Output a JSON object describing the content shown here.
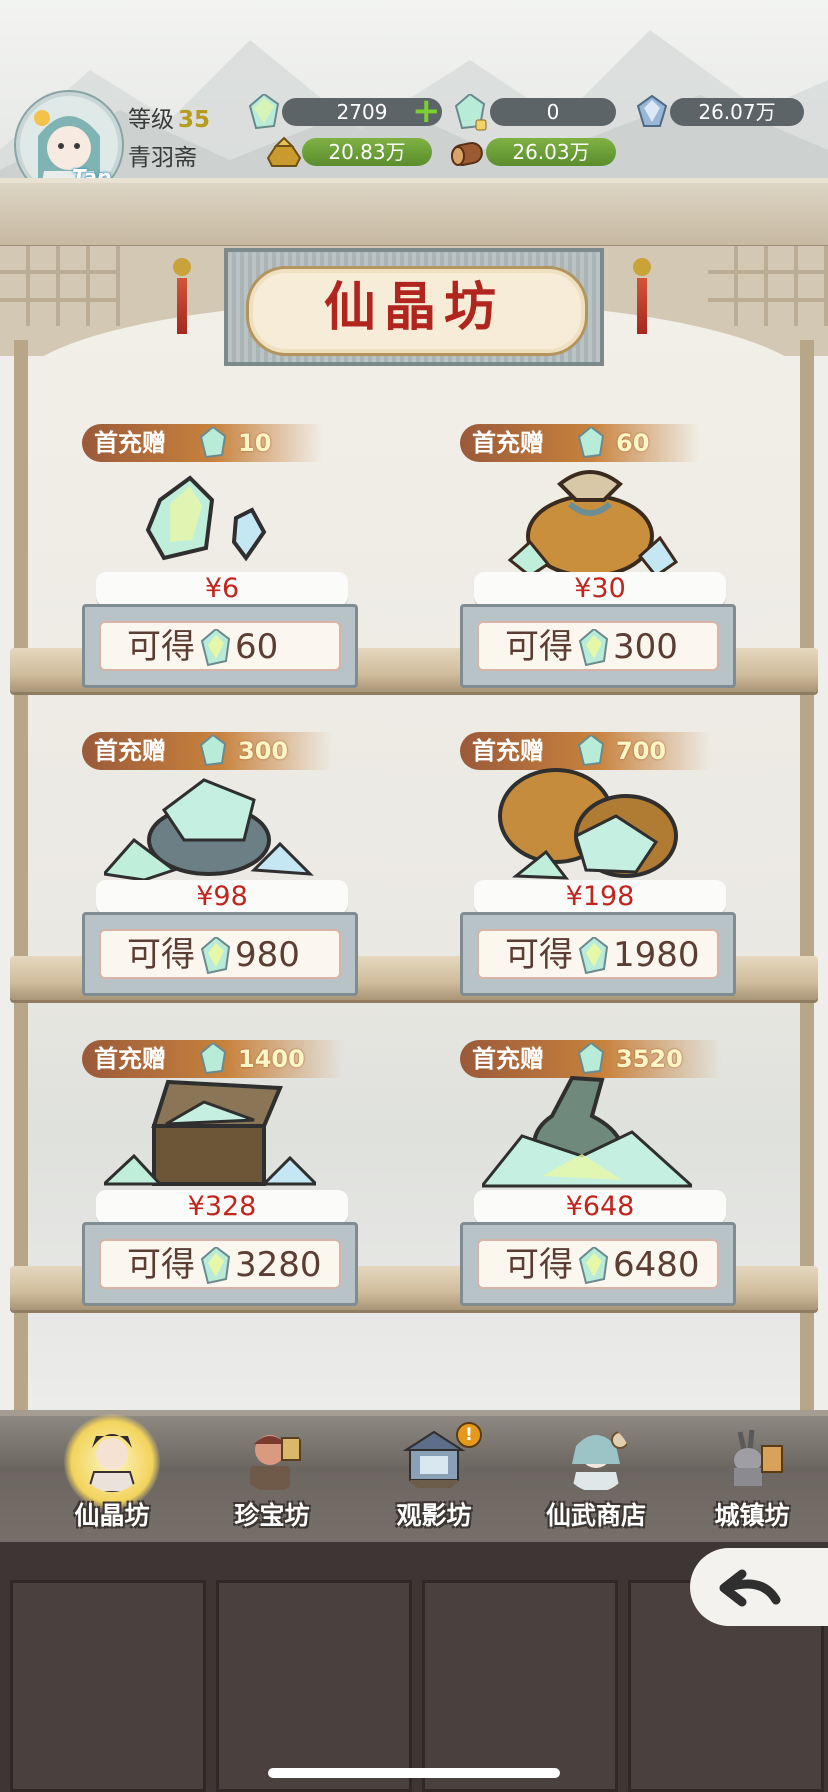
{
  "header": {
    "level_label": "等级",
    "level_value": "35",
    "player_name": "青羽斋",
    "avatar_badge": "Tap",
    "resources": {
      "crystal": "2709",
      "bound_crystal": "0",
      "spirit_stone": "26.07万",
      "gold": "20.83万",
      "wood": "26.03万"
    }
  },
  "shop": {
    "title": "仙晶坊",
    "bonus_label": "首充赠",
    "get_label": "可得",
    "items": [
      {
        "bonus": "10",
        "price": "¥6",
        "get": "60"
      },
      {
        "bonus": "60",
        "price": "¥30",
        "get": "300"
      },
      {
        "bonus": "300",
        "price": "¥98",
        "get": "980"
      },
      {
        "bonus": "700",
        "price": "¥198",
        "get": "1980"
      },
      {
        "bonus": "1400",
        "price": "¥328",
        "get": "3280"
      },
      {
        "bonus": "3520",
        "price": "¥648",
        "get": "6480"
      }
    ]
  },
  "nav": {
    "tabs": [
      {
        "label": "仙晶坊",
        "icon": "fairy-crystal-shop-icon",
        "active": true
      },
      {
        "label": "珍宝坊",
        "icon": "treasure-shop-icon"
      },
      {
        "label": "观影坊",
        "icon": "theater-icon",
        "alert": "!"
      },
      {
        "label": "仙武商店",
        "icon": "martial-shop-icon"
      },
      {
        "label": "城镇坊",
        "icon": "town-shop-icon"
      }
    ]
  },
  "colors": {
    "price_red": "#c0261f",
    "title_red": "#b0261f",
    "resource_green": "#5a8e2e",
    "resource_dark": "#5d6467"
  }
}
